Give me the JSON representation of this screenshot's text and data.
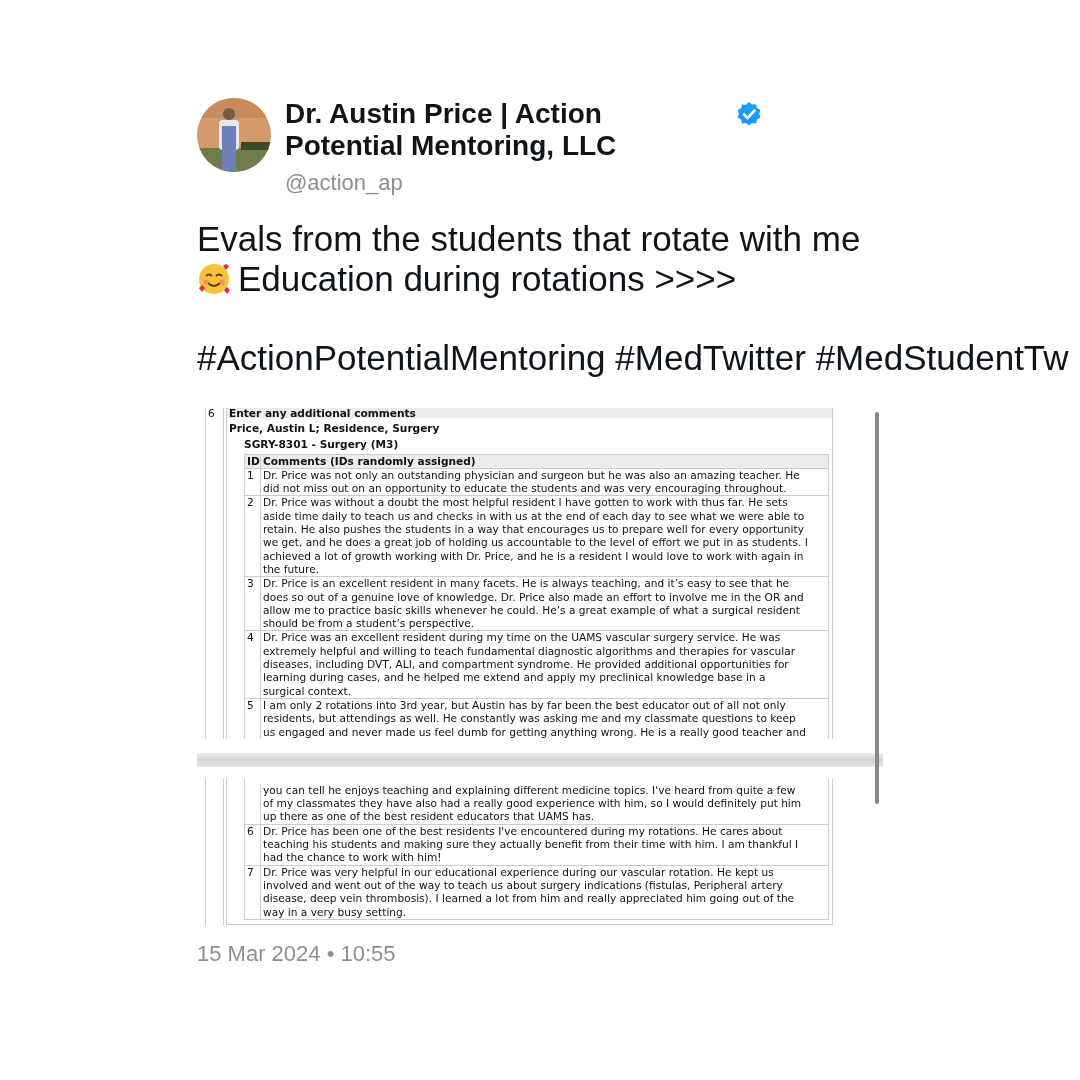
{
  "author": {
    "name_lines": [
      "Dr. Austin Price | Action",
      "Potential Mentoring, LLC"
    ],
    "handle": "@action_ap",
    "verified": true
  },
  "tweet": {
    "line_1": "Evals from the students that rotate with me",
    "line_2": "Education during rotations >>>>",
    "hashtags": "#ActionPotentialMentoring #MedTwitter #MedStudentTw"
  },
  "document": {
    "section_number": "6",
    "section_title": "Enter any additional comments",
    "person": "Price, Austin L; Residence, Surgery",
    "course": "SGRY-8301 - Surgery (M3)",
    "columns": [
      "ID",
      "Comments (IDs randomly assigned)"
    ],
    "panes": [
      {
        "rows": [
          {
            "id": "1",
            "lines": [
              "Dr. Price was not only an outstanding physician and surgeon but he was also an amazing teacher. He",
              "did not miss out on an opportunity to educate the students and was very encouraging throughout."
            ]
          },
          {
            "id": "2",
            "lines": [
              "Dr. Price was without a doubt the most helpful resident I have gotten to work with thus far. He sets",
              "aside time daily to teach us and checks in with us at the end of each day to see what we were able to",
              "retain. He also pushes the students in a way that encourages us to prepare well for every opportunity",
              "we get, and he does a great job of holding us accountable to the level of effort we put in as students. I",
              "achieved a lot of growth working with Dr. Price, and he is a resident I would love to work with again in",
              "the future."
            ]
          },
          {
            "id": "3",
            "lines": [
              "Dr. Price is an excellent resident in many facets. He is always teaching, and it’s easy to see that he",
              "does so out of a genuine love of knowledge. Dr. Price also made an effort to involve me in the OR and",
              "allow me to practice basic skills whenever he could. He’s a great example of what a surgical resident",
              "should be from a student’s perspective."
            ]
          },
          {
            "id": "4",
            "lines": [
              "Dr. Price was an excellent resident during my time on the UAMS vascular surgery service. He was",
              "extremely helpful and willing to teach fundamental diagnostic algorithms and therapies for vascular",
              "diseases, including DVT, ALI, and compartment syndrome. He provided additional opportunities for",
              "learning during cases, and he helped me extend and apply my preclinical knowledge base in a",
              "surgical context."
            ]
          },
          {
            "id": "5",
            "lines": [
              "I am only 2 rotations into 3rd year, but Austin has by far been the best educator out of all not only",
              "residents, but attendings as well. He constantly was asking me and my classmate questions to keep",
              "us engaged and never made us feel dumb for getting anything wrong. He is a really good teacher and"
            ]
          }
        ]
      },
      {
        "rows": [
          {
            "lines": [
              "you can tell he enjoys teaching and explaining different medicine topics. I've heard from quite a few",
              "of my classmates they have also had a really good experience with him, so I would definitely put him",
              "up there as one of the best resident educators that UAMS has."
            ]
          },
          {
            "id": "6",
            "lines": [
              "Dr. Price has been one of the best residents I've encountered during my rotations. He cares about",
              "teaching his students and making sure they actually benefit from their time with him. I am thankful I",
              "had the chance to work with him!"
            ]
          },
          {
            "id": "7",
            "lines": [
              "Dr. Price was very helpful in our educational experience during our vascular rotation. He kept us",
              "involved and went out of the way to teach us about surgery indications (fistulas, Peripheral artery",
              "disease, deep vein thrombosis). I learned a lot from him and really appreciated him going out of the",
              "way in a very busy setting."
            ]
          }
        ]
      }
    ]
  },
  "timestamp": "15 Mar 2024 • 10:55"
}
